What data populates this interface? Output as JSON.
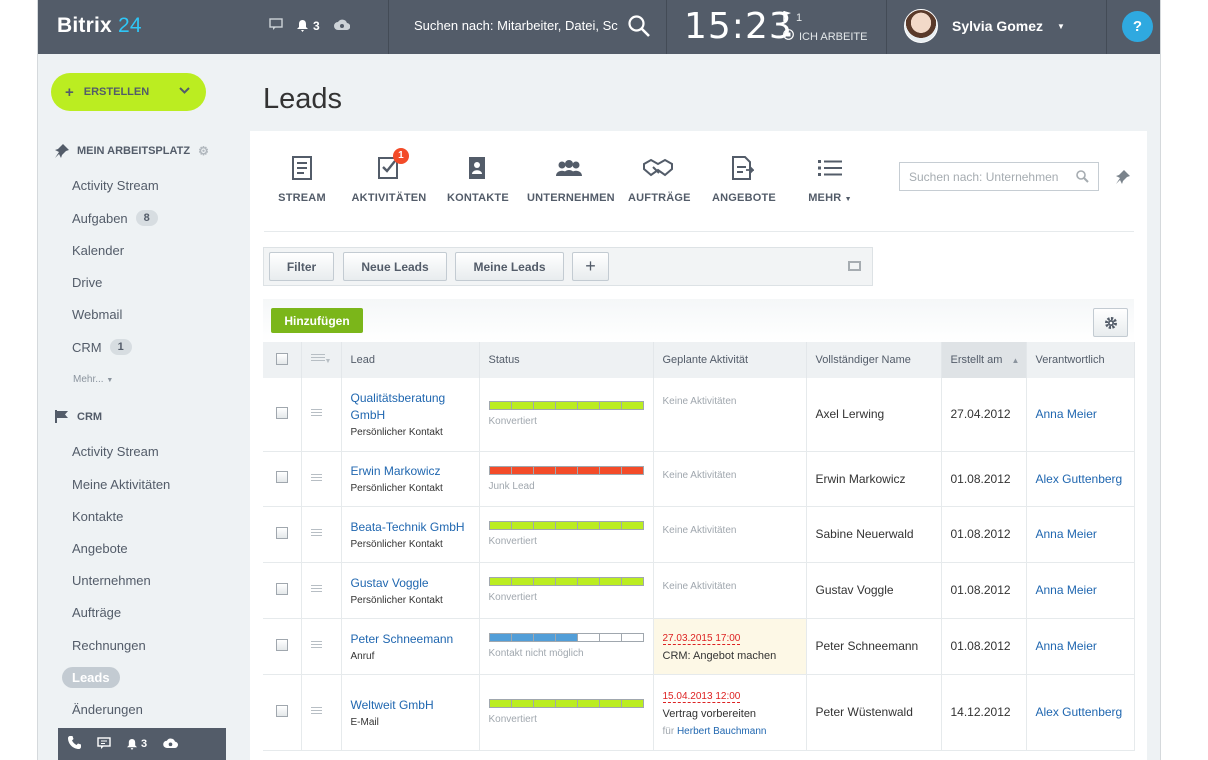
{
  "header": {
    "logo_main": "Bitrix",
    "logo_num": "24",
    "notifications": "3",
    "search_text": "Suchen nach: Mitarbeiter, Datei, Sc",
    "clock": "15:23",
    "flag_count": "1",
    "work_status": "ICH ARBEITE",
    "user_name": "Sylvia Gomez",
    "help": "?"
  },
  "sidebar": {
    "create_label": "ERSTELLEN",
    "section1_title": "MEIN ARBEITSPLATZ",
    "section1_items": [
      {
        "label": "Activity Stream",
        "badge": ""
      },
      {
        "label": "Aufgaben",
        "badge": "8"
      },
      {
        "label": "Kalender",
        "badge": ""
      },
      {
        "label": "Drive",
        "badge": ""
      },
      {
        "label": "Webmail",
        "badge": ""
      },
      {
        "label": "CRM",
        "badge": "1"
      }
    ],
    "more_label": "Mehr...",
    "section2_title": "CRM",
    "section2_items": [
      {
        "label": "Activity Stream"
      },
      {
        "label": "Meine Aktivitäten"
      },
      {
        "label": "Kontakte"
      },
      {
        "label": "Angebote"
      },
      {
        "label": "Unternehmen"
      },
      {
        "label": "Aufträge"
      },
      {
        "label": "Rechnungen"
      }
    ],
    "active_item": "Leads",
    "after_active": "Änderungen",
    "bottom_count": "3"
  },
  "main": {
    "title": "Leads",
    "toolbar": [
      {
        "label": "STREAM",
        "icon": "stream-icon"
      },
      {
        "label": "AKTIVITÄTEN",
        "icon": "activities-icon",
        "badge": "1"
      },
      {
        "label": "KONTAKTE",
        "icon": "contacts-icon"
      },
      {
        "label": "UNTERNEHMEN",
        "icon": "companies-icon"
      },
      {
        "label": "AUFTRÄGE",
        "icon": "deals-icon"
      },
      {
        "label": "ANGEBOTE",
        "icon": "quotes-icon"
      },
      {
        "label": "MEHR",
        "icon": "more-icon"
      }
    ],
    "search_placeholder": "Suchen nach: Unternehmen",
    "filters": {
      "filter": "Filter",
      "new_leads": "Neue Leads",
      "my_leads": "Meine Leads",
      "add": "+"
    },
    "add_button": "Hinzufügen",
    "columns": [
      "Lead",
      "Status",
      "Geplante Aktivität",
      "Vollständiger Name",
      "Erstellt am",
      "Verantwortlich"
    ],
    "rows": [
      {
        "lead": "Qualitätsberatung GmbH",
        "source": "Persönlicher Kontakt",
        "status": "Konvertiert",
        "status_color": "green",
        "progress": 7,
        "activity_date": "",
        "activity_text": "Keine Aktivitäten",
        "activity_for": "",
        "activity_person": "",
        "name": "Axel Lerwing",
        "created": "27.04.2012",
        "responsible": "Anna Meier"
      },
      {
        "lead": "Erwin Markowicz",
        "source": "Persönlicher Kontakt",
        "status": "Junk Lead",
        "status_color": "red",
        "progress": 7,
        "activity_date": "",
        "activity_text": "Keine Aktivitäten",
        "activity_for": "",
        "activity_person": "",
        "name": "Erwin Markowicz",
        "created": "01.08.2012",
        "responsible": "Alex Guttenberg"
      },
      {
        "lead": "Beata-Technik GmbH",
        "source": "Persönlicher Kontakt",
        "status": "Konvertiert",
        "status_color": "green",
        "progress": 7,
        "activity_date": "",
        "activity_text": "Keine Aktivitäten",
        "activity_for": "",
        "activity_person": "",
        "name": "Sabine Neuerwald",
        "created": "01.08.2012",
        "responsible": "Anna Meier"
      },
      {
        "lead": "Gustav Voggle",
        "source": "Persönlicher Kontakt",
        "status": "Konvertiert",
        "status_color": "green",
        "progress": 7,
        "activity_date": "",
        "activity_text": "Keine Aktivitäten",
        "activity_for": "",
        "activity_person": "",
        "name": "Gustav Voggle",
        "created": "01.08.2012",
        "responsible": "Anna Meier"
      },
      {
        "lead": "Peter Schneemann",
        "source": "Anruf",
        "status": "Kontakt nicht möglich",
        "status_color": "blue",
        "progress": 4,
        "activity_date": "27.03.2015 17:00",
        "activity_text": "CRM: Angebot machen",
        "activity_for": "",
        "activity_person": "",
        "name": "Peter Schneemann",
        "created": "01.08.2012",
        "responsible": "Anna Meier"
      },
      {
        "lead": "Weltweit GmbH",
        "source": "E-Mail",
        "status": "Konvertiert",
        "status_color": "green",
        "progress": 7,
        "activity_date": "15.04.2013 12:00",
        "activity_text": "Vertrag vorbereiten",
        "activity_for": "für",
        "activity_person": "Herbert Bauchmann",
        "name": "Peter Wüstenwald",
        "created": "14.12.2012",
        "responsible": "Alex Guttenberg"
      }
    ]
  }
}
